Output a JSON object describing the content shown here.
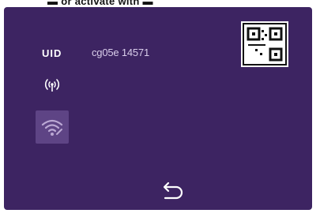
{
  "banner": {
    "text": "▬ or activate with ▬"
  },
  "device": {
    "uid_label": "UID",
    "uid_value": "cg05e 14571"
  },
  "icons": {
    "signal": "wireless-signal-icon",
    "wifi": "wifi-icon",
    "qr": "qr-code-icon",
    "back": "back-arrow-icon"
  },
  "colors": {
    "screen_background": "#3d2462",
    "wifi_button_background": "#5e4485",
    "text": "#ffffff"
  }
}
